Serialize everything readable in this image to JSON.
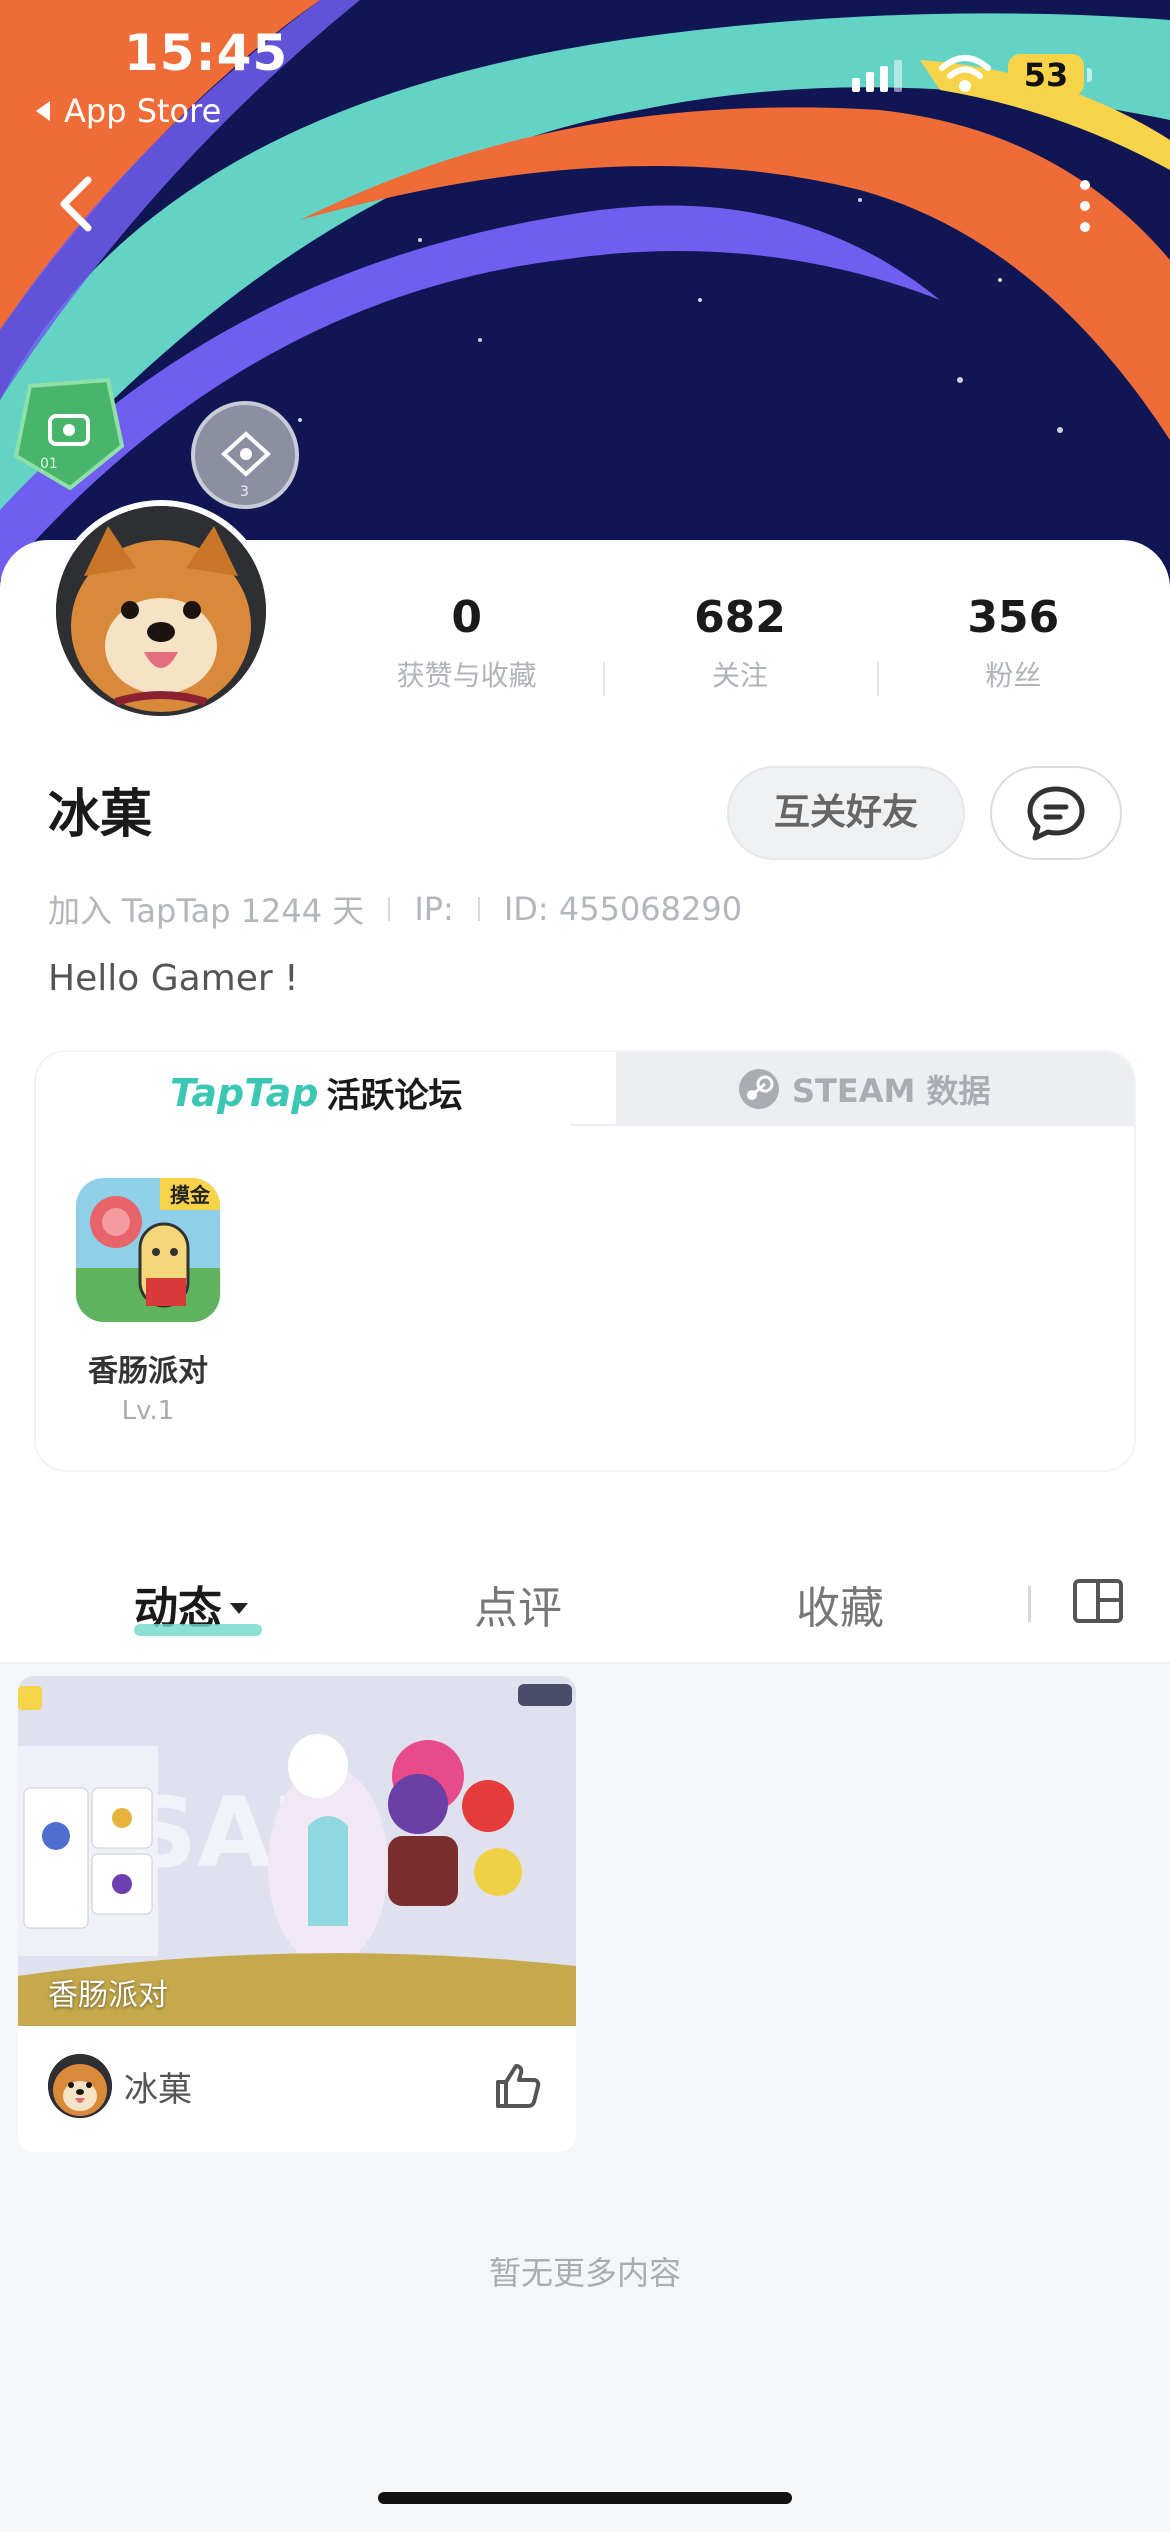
{
  "status_bar": {
    "time": "15:45",
    "back_app": "App Store",
    "battery": "53"
  },
  "profile": {
    "name": "冰菓",
    "stats": [
      {
        "value": "0",
        "label": "获赞与收藏"
      },
      {
        "value": "682",
        "label": "关注"
      },
      {
        "value": "356",
        "label": "粉丝"
      }
    ],
    "mutual_label": "互关好友",
    "meta": {
      "joined": "加入 TapTap 1244 天",
      "ip": "IP:",
      "id": "ID: 455068290"
    },
    "bio": "Hello Gamer !"
  },
  "panel": {
    "tab1_brand": "TapTap",
    "tab1_label": "活跃论坛",
    "tab2_label": "STEAM 数据",
    "game": {
      "name": "香肠派对",
      "level": "Lv.1",
      "icon_badge": "摸金"
    }
  },
  "feed_tabs": [
    "动态",
    "点评",
    "收藏"
  ],
  "post": {
    "tag": "香肠派对",
    "author": "冰菓"
  },
  "empty_text": "暂无更多内容",
  "colors": {
    "accent": "#3cc7b5",
    "banner_bg": "#101654",
    "teal": "#62d3c4",
    "orange": "#ef6b37",
    "purple": "#6f5ef0",
    "yellow": "#f7d34a"
  }
}
